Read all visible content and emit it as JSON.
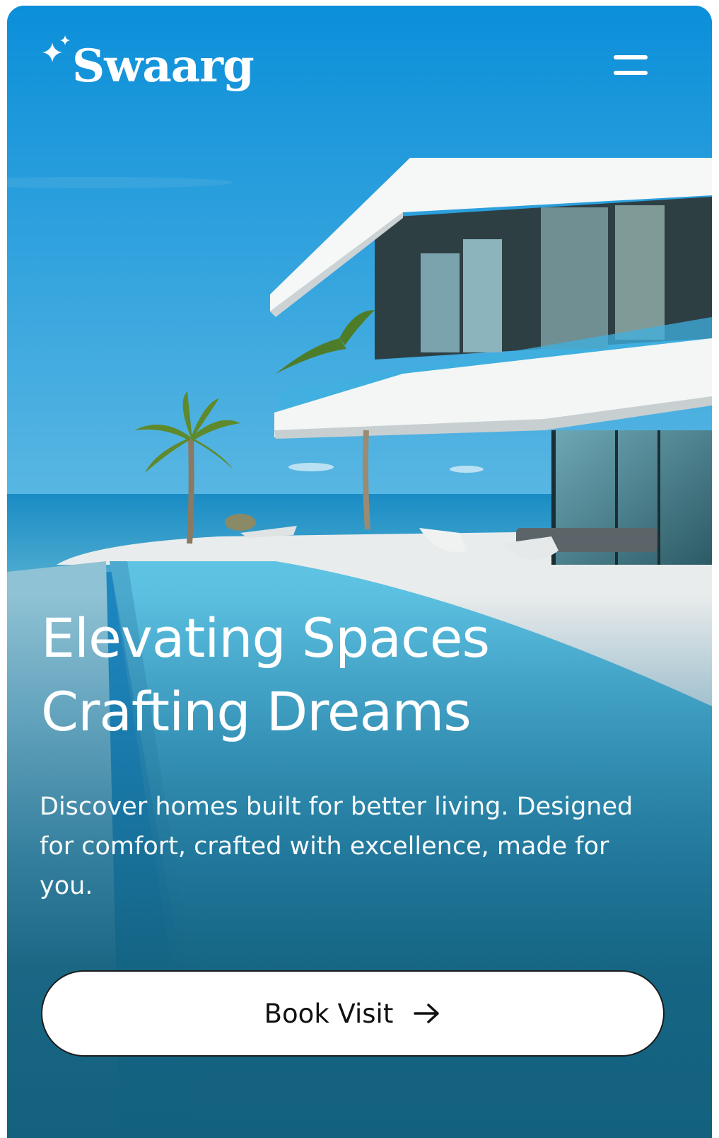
{
  "brand": {
    "name": "Swaarg"
  },
  "header": {
    "menu_icon": "hamburger-menu-icon",
    "logo_icon": "sparkle-icon"
  },
  "hero": {
    "headline_line1": "Elevating Spaces",
    "headline_line2": "Crafting Dreams",
    "subtext": "Discover homes built for better living. Designed for comfort, crafted with excellence, made for you.",
    "background_image": "modern beach villa with infinity pool and palm trees"
  },
  "cta": {
    "label": "Book Visit",
    "icon": "arrow-right-icon"
  },
  "colors": {
    "sky": "#0a8fd8",
    "sea": "#1c86c0",
    "bottom": "#13617f",
    "text": "#ffffff",
    "button_bg": "#ffffff",
    "button_text": "#111111"
  }
}
